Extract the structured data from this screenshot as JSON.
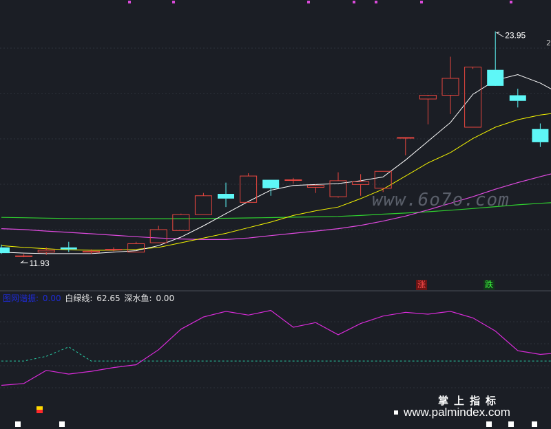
{
  "watermark": "www.6o7o.com",
  "brand": {
    "cn": "掌上指标",
    "url": "www.palmindex.com"
  },
  "price_axis_edge_label": "2",
  "badges": {
    "rise": "涨",
    "fall": "跌"
  },
  "indicator_legend": [
    {
      "name": "图网谐振:",
      "value": "0.00"
    },
    {
      "name": "白绿线:",
      "value": "62.65"
    },
    {
      "name": "深水鱼:",
      "value": "0.00"
    }
  ],
  "colors": {
    "background": "#1b1e25",
    "up_candle": "#e8463f",
    "down_candle": "#5ef7f7",
    "ma_white": "#ffffff",
    "ma_yellow": "#f5f500",
    "ma_magenta": "#e04ae0",
    "ma_green": "#2fd02f",
    "indicator_line": "#d92bd9",
    "indicator_dash": "#28c9a3"
  },
  "chart_data": [
    {
      "type": "candlestick",
      "title": "",
      "price_range": [
        10.8,
        25.4
      ],
      "max_label": "23.95",
      "min_label": "11.93",
      "candles": [
        {
          "o": 12.45,
          "h": 12.6,
          "l": 12.1,
          "c": 12.15
        },
        {
          "o": 12.0,
          "h": 12.1,
          "l": 11.93,
          "c": 12.0
        },
        {
          "o": 12.2,
          "h": 12.45,
          "l": 12.05,
          "c": 12.3
        },
        {
          "o": 12.45,
          "h": 12.75,
          "l": 12.2,
          "c": 12.35
        },
        {
          "o": 12.2,
          "h": 12.35,
          "l": 12.1,
          "c": 12.25
        },
        {
          "o": 12.35,
          "h": 12.45,
          "l": 12.25,
          "c": 12.35
        },
        {
          "o": 12.2,
          "h": 12.75,
          "l": 12.2,
          "c": 12.65
        },
        {
          "o": 12.7,
          "h": 13.6,
          "l": 12.7,
          "c": 13.4
        },
        {
          "o": 13.35,
          "h": 14.25,
          "l": 13.35,
          "c": 14.2
        },
        {
          "o": 14.2,
          "h": 15.35,
          "l": 14.2,
          "c": 15.2
        },
        {
          "o": 15.3,
          "h": 15.9,
          "l": 14.6,
          "c": 15.05
        },
        {
          "o": 14.85,
          "h": 16.4,
          "l": 14.85,
          "c": 16.25
        },
        {
          "o": 16.05,
          "h": 16.05,
          "l": 15.2,
          "c": 15.6
        },
        {
          "o": 16.05,
          "h": 16.15,
          "l": 15.85,
          "c": 16.05
        },
        {
          "o": 15.65,
          "h": 15.8,
          "l": 15.35,
          "c": 15.75
        },
        {
          "o": 15.15,
          "h": 16.45,
          "l": 15.1,
          "c": 16.0
        },
        {
          "o": 15.8,
          "h": 16.35,
          "l": 15.2,
          "c": 15.95
        },
        {
          "o": 15.6,
          "h": 16.5,
          "l": 15.4,
          "c": 16.5
        },
        {
          "o": 18.3,
          "h": 18.3,
          "l": 17.35,
          "c": 18.3
        },
        {
          "o": 20.35,
          "h": 20.5,
          "l": 19.0,
          "c": 20.55
        },
        {
          "o": 20.55,
          "h": 22.6,
          "l": 19.55,
          "c": 21.45
        },
        {
          "o": 18.85,
          "h": 21.95,
          "l": 18.85,
          "c": 22.05
        },
        {
          "o": 21.9,
          "h": 23.95,
          "l": 21.6,
          "c": 21.05
        },
        {
          "o": 20.55,
          "h": 20.9,
          "l": 19.9,
          "c": 20.25
        },
        {
          "o": 18.75,
          "h": 19.05,
          "l": 17.8,
          "c": 18.05
        },
        {
          "o": 17.25,
          "h": 17.45,
          "l": 16.85,
          "c": 17.25
        },
        {
          "o": 17.1,
          "h": 17.55,
          "l": 16.65,
          "c": 17.55
        }
      ],
      "ma_white": [
        12.2,
        12.15,
        12.12,
        12.12,
        12.12,
        12.2,
        12.28,
        12.55,
        13.0,
        13.6,
        14.25,
        14.9,
        15.5,
        15.75,
        15.8,
        15.85,
        16.0,
        16.2,
        17.1,
        18.1,
        19.1,
        20.6,
        21.35,
        21.65,
        21.2,
        20.55,
        19.7
      ],
      "ma_yellow": [
        12.55,
        12.45,
        12.38,
        12.32,
        12.3,
        12.3,
        12.35,
        12.45,
        12.7,
        12.95,
        13.2,
        13.5,
        13.8,
        14.15,
        14.4,
        14.6,
        15.05,
        15.55,
        16.25,
        16.95,
        17.5,
        18.25,
        18.85,
        19.25,
        19.5,
        19.65,
        19.85
      ],
      "ma_magenta": [
        13.45,
        13.4,
        13.32,
        13.25,
        13.18,
        13.1,
        13.02,
        12.95,
        12.9,
        12.87,
        12.87,
        12.95,
        13.08,
        13.2,
        13.32,
        13.45,
        13.62,
        13.85,
        14.12,
        14.45,
        14.8,
        15.15,
        15.55,
        15.9,
        16.22,
        16.52,
        16.85
      ],
      "ma_green": [
        14.05,
        14.03,
        14.01,
        13.99,
        13.98,
        13.98,
        13.98,
        13.98,
        13.98,
        13.99,
        14.0,
        14.02,
        14.04,
        14.06,
        14.08,
        14.1,
        14.15,
        14.22,
        14.28,
        14.35,
        14.43,
        14.52,
        14.62,
        14.72,
        14.8,
        14.86,
        14.92
      ]
    },
    {
      "type": "line",
      "title": "",
      "ylim": [
        -5,
        100
      ],
      "series": [
        {
          "name": "白绿线",
          "values": [
            13,
            15,
            29,
            25,
            28,
            32,
            35,
            51,
            73,
            86,
            92,
            88,
            93,
            75,
            80,
            67,
            79,
            87,
            91,
            89,
            92,
            85,
            71,
            50,
            46,
            48,
            48
          ]
        },
        {
          "name": "深水鱼",
          "values": [
            39,
            39,
            44,
            54,
            39,
            39,
            39,
            39,
            39,
            39,
            39,
            39,
            39,
            39,
            39,
            39,
            39,
            39,
            39,
            39,
            39,
            39,
            39,
            39,
            39,
            39,
            39
          ]
        }
      ]
    }
  ]
}
